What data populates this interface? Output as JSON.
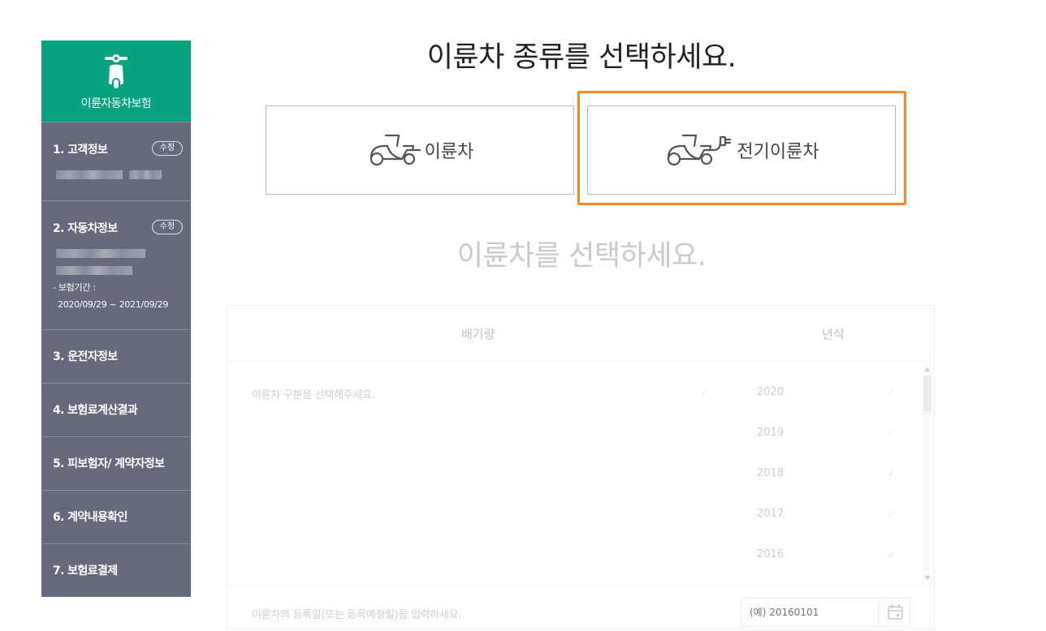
{
  "sidebar": {
    "header_title": "이륜자동차보험",
    "header_icon": "scooter-icon",
    "steps": [
      {
        "label": "1. 고객정보",
        "edit": "수정"
      },
      {
        "label": "2. 자동차정보",
        "edit": "수정",
        "period_label": "- 보험기간 :",
        "period_value": "2020/09/29 ~ 2021/09/29"
      },
      {
        "label": "3. 운전자정보"
      },
      {
        "label": "4. 보험료계산결과"
      },
      {
        "label": "5. 피보험자/ 계약자정보"
      },
      {
        "label": "6. 계약내용확인"
      },
      {
        "label": "7. 보험료결제"
      }
    ],
    "colors": {
      "header": "#07a27f",
      "step": "#646a7b"
    }
  },
  "main": {
    "title": "이륜차 종류를 선택하세요.",
    "types": [
      {
        "label": "이륜차",
        "icon": "scooter-outline-icon"
      },
      {
        "label": "전기이륜차",
        "icon": "electric-scooter-icon"
      }
    ],
    "highlight_color": "#f08a2b",
    "subtitle": "이륜차를 선택하세요.",
    "table": {
      "col_displacement": "배기량",
      "col_year": "년식",
      "displacement_placeholder": "이륜차 구분을 선택해주세요.",
      "years": [
        "2020",
        "2019",
        "2018",
        "2017",
        "2016"
      ]
    },
    "registration": {
      "label": "이륜차의 등록일(또는 등록예정일)을 입력하세요.",
      "placeholder": "(예) 20160101"
    }
  }
}
